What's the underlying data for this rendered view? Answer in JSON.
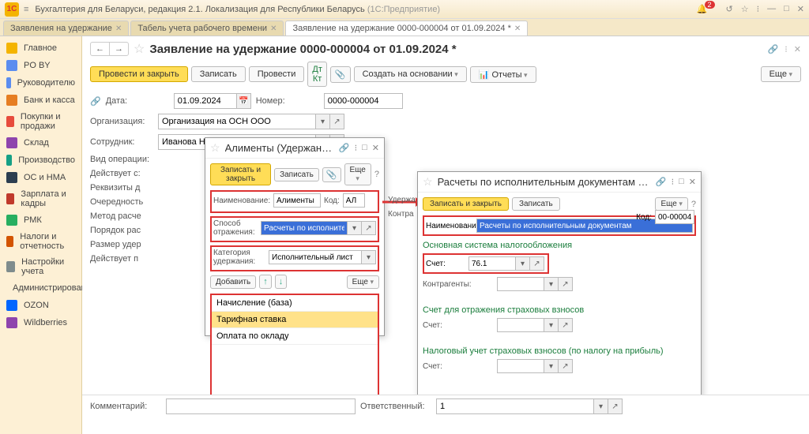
{
  "titlebar": {
    "app": "Бухгалтерия для Беларуси, редакция 2.1. Локализация для Республики Беларусь",
    "suffix": "(1С:Предприятие)"
  },
  "tabs": [
    {
      "label": "Заявления на удержание",
      "active": false
    },
    {
      "label": "Табель учета рабочего времени",
      "active": false
    },
    {
      "label": "Заявление на удержание 0000-000004 от 01.09.2024 *",
      "active": true
    }
  ],
  "nav": [
    "Главное",
    "PO BY",
    "Руководителю",
    "Банк и касса",
    "Покупки и продажи",
    "Склад",
    "Производство",
    "ОС и НМА",
    "Зарплата и кадры",
    "РМК",
    "Налоги и отчетность",
    "Настройки учета",
    "Администрирование",
    "OZON",
    "Wildberries"
  ],
  "nav_colors": [
    "#f4b400",
    "#5b8def",
    "#5b8def",
    "#e67e22",
    "#e74c3c",
    "#8e44ad",
    "#16a085",
    "#2c3e50",
    "#c0392b",
    "#27ae60",
    "#d35400",
    "#7f8c8d",
    "#34495e",
    "#0066ff",
    "#8e44ad"
  ],
  "doc": {
    "title": "Заявление на удержание 0000-000004 от 01.09.2024 *",
    "toolbar": {
      "post_close": "Провести и закрыть",
      "write": "Записать",
      "post": "Провести",
      "create_based": "Создать на основании",
      "reports": "Отчеты",
      "more": "Еще"
    },
    "date_label": "Дата:",
    "date": "01.09.2024",
    "number_label": "Номер:",
    "number": "0000-000004",
    "org_label": "Организация:",
    "org": "Организация на ОСН ООО",
    "emp_label": "Сотрудник:",
    "emp": "Иванова Наталья Игоревна",
    "op_label": "Вид операции:",
    "eff_label": "Действует с:",
    "req_label": "Реквизиты д",
    "ord_label": "Очередность",
    "method_label": "Метод расче",
    "calc_order_label": "Порядок рас",
    "size_label": "Размер удер",
    "eff_to_label": "Действует п",
    "comment_label": "Комментарий:",
    "responsible_label": "Ответственный:",
    "responsible": "1"
  },
  "modal1": {
    "title": "Алименты (Удержание)",
    "write_close": "Записать и закрыть",
    "write": "Записать",
    "more": "Еще",
    "name_label": "Наименование:",
    "name": "Алименты",
    "code_label": "Код:",
    "code": "АЛ",
    "refl_label": "Способ отражения:",
    "refl": "Расчеты по исполнительным докум",
    "cat_label": "Категория удержания:",
    "cat": "Исполнительный лист",
    "add": "Добавить",
    "list": [
      "Начисление (база)",
      "Тарифная ставка",
      "Оплата по окладу"
    ]
  },
  "modal2": {
    "title": "Расчеты по исполнительным документам (Способ от...",
    "write_close": "Записать и закрыть",
    "write": "Записать",
    "more": "Еще",
    "name_label": "Наименование:",
    "name": "Расчеты по исполнительным документам",
    "code_label": "Код:",
    "code": "00-00004",
    "section1": "Основная система налогообложения",
    "account_label": "Счет:",
    "account": "76.1",
    "contr_label": "Контрагенты:",
    "section2": "Счет для отражения страховых взносов",
    "section3": "Налоговый учет страховых взносов (по налогу на прибыль)",
    "hold_label": "Удержа",
    "contract_label": "Контра"
  },
  "badge_count": "2"
}
